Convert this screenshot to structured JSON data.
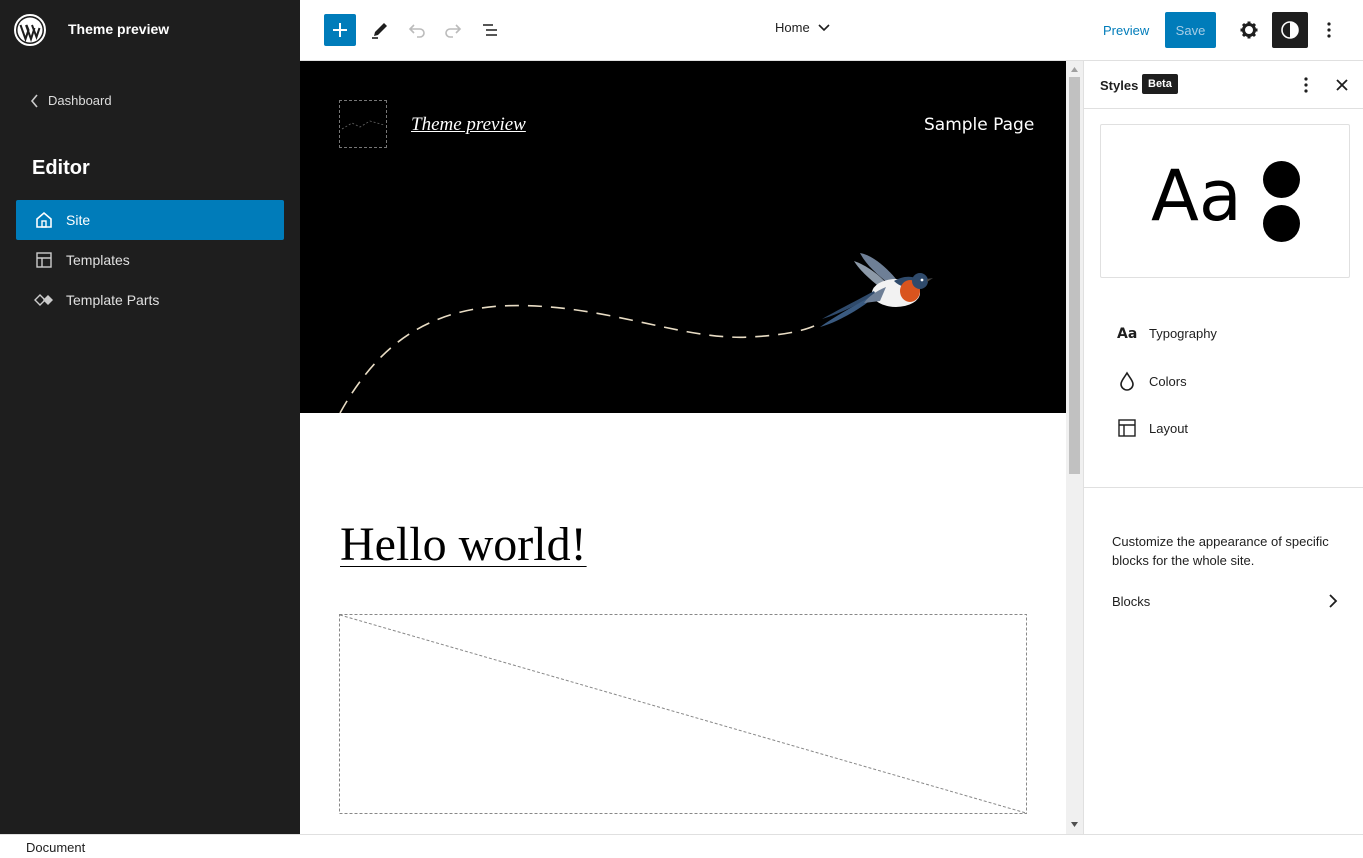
{
  "sidebar": {
    "site_title": "Theme preview",
    "back_label": "Dashboard",
    "heading": "Editor",
    "items": [
      {
        "label": "Site",
        "icon": "home-icon",
        "active": true
      },
      {
        "label": "Templates",
        "icon": "layout-icon",
        "active": false
      },
      {
        "label": "Template Parts",
        "icon": "symbol-icon",
        "active": false
      }
    ]
  },
  "toolbar": {
    "document_title": "Home",
    "preview_label": "Preview",
    "save_label": "Save"
  },
  "canvas": {
    "site_link": "Theme preview",
    "nav_item": "Sample Page",
    "post_title": "Hello world!"
  },
  "panel": {
    "title": "Styles",
    "badge": "Beta",
    "preview_text": "Aa",
    "menu": [
      {
        "label": "Typography",
        "icon": "typography-icon"
      },
      {
        "label": "Colors",
        "icon": "droplet-icon"
      },
      {
        "label": "Layout",
        "icon": "layout-icon"
      }
    ],
    "help_text": "Customize the appearance of specific blocks for the whole site.",
    "blocks_label": "Blocks"
  },
  "footer": {
    "label": "Document"
  },
  "colors": {
    "accent": "#007cba",
    "sidebar_bg": "#1e1e1e",
    "hero_bg": "#000000"
  }
}
